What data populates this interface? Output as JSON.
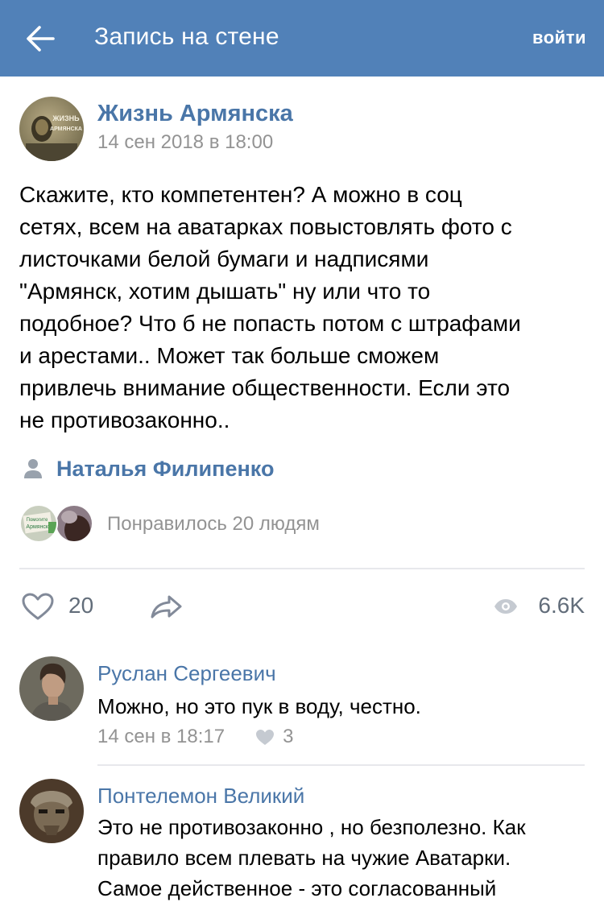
{
  "header": {
    "title": "Запись на стене",
    "login_label": "войти",
    "bg_color": "#5181b8"
  },
  "post": {
    "author": "Жизнь Армянска",
    "avatar_text": [
      "ЖИЗНЬ",
      "АРМЯНСКА"
    ],
    "date": "14 сен 2018 в 18:00",
    "text_lines": [
      "Скажите, кто компетентен?  А можно в соц",
      "сетях, всем на аватарках повыстовлять фото с",
      "листочками белой бумаги и надписями",
      "\"Армянск, хотим дышать\" ну или что то",
      "подобное?  Что б не попасть потом с штрафами",
      "и арестами.. Может так больше сможем",
      "привлечь внимание общественности. Если это",
      "не противозаконно.."
    ],
    "signer": "Наталья Филипенко",
    "likers_summary": "Понравилось 20 людям",
    "liker_avatar_text": [
      "Помогите",
      "Армянску"
    ],
    "like_count": "20",
    "views": "6.6K"
  },
  "comments": [
    {
      "author": "Руслан Сергеевич",
      "text_lines": [
        "Можно, но это пук в воду, честно."
      ],
      "date": "14 сен в 18:17",
      "likes": "3"
    },
    {
      "author": "Понтелемон Великий",
      "text_lines": [
        "Это не противозаконно , но безполезно. Как",
        "правило всем плевать на чужие Аватарки.",
        "Самое действенное - это согласованный"
      ]
    }
  ],
  "icons": {
    "back": "arrow-left",
    "signer": "person-icon",
    "like": "heart-outline",
    "share": "share-arrow",
    "views": "eye"
  },
  "colors": {
    "link": "#4a76a8",
    "secondary": "#939393",
    "action": "#626d7a",
    "divider": "#e7e8ec"
  }
}
